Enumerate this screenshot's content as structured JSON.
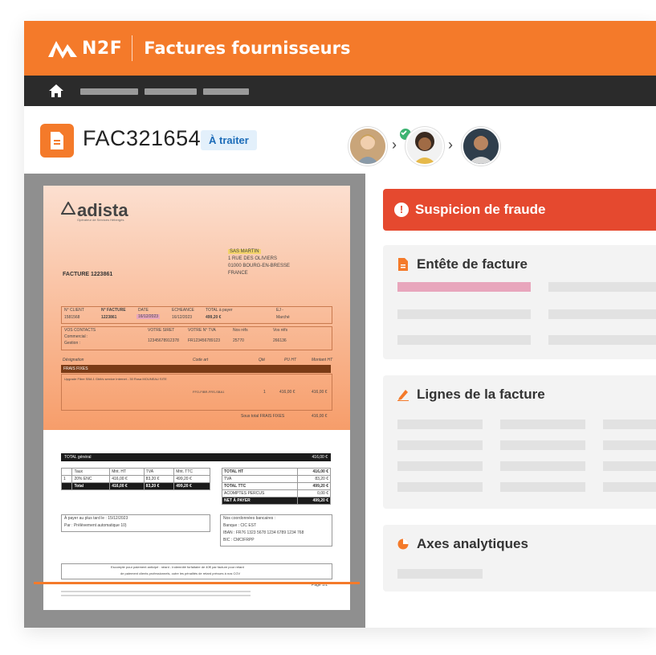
{
  "brand": {
    "logo_text": "N2F",
    "app_title": "Factures fournisseurs",
    "accent": "#f47a2a"
  },
  "navbar": {
    "home_label": "Accueil"
  },
  "invoice": {
    "id": "FAC321654",
    "status": "À traiter"
  },
  "approvers": [
    {
      "name": "approver-1",
      "approved": true
    },
    {
      "name": "approver-2",
      "approved": false
    },
    {
      "name": "approver-3",
      "approved": false
    }
  ],
  "document": {
    "supplier": "adista",
    "supplier_tagline": "Opérateur de Services Hébergés",
    "bill_to_name": "SAS MARTIN",
    "bill_to_lines": [
      "1 RUE DES OLIVIERS",
      "01000 BOURG-EN-BRESSE",
      "FRANCE"
    ],
    "title": "FACTURE 1223861",
    "meta_headers": [
      "N° CLIENT",
      "N° FACTURE",
      "DATE",
      "ECHEANCE",
      "TOTAL à payer",
      "EJ -"
    ],
    "meta_values": [
      "1581568",
      "1223861",
      "16/12/2023",
      "16/12/2023",
      "499,20 €",
      "Marché"
    ],
    "contacts_headers": [
      "VOS CONTACTS",
      "VOTRE SIRET",
      "VOTRE N° TVA",
      "Nos réfs",
      "Vos réfs"
    ],
    "contacts_labels": [
      "Commercial :",
      "Gestion :"
    ],
    "contacts_values": [
      "12345678912378",
      "FR123456789123",
      "25770",
      "266136"
    ],
    "lines_headers": [
      "Désignation",
      "Code art",
      "Qté",
      "PU HT",
      "Montant HT"
    ],
    "section": "FRAIS FIXES",
    "line_desc": "Upgrade Fibre SBA 1 Gbit/s service Internet - 30 Rosa MOUNEAU SITE",
    "line_code": "FFO-FIBR-FRS-SBA1",
    "line_qty": "1",
    "line_pu": "416,00 €",
    "line_amount": "416,00 €",
    "subtotal_label": "Sous total FRAIS FIXES",
    "subtotal_value": "416,00 €",
    "total_general_label": "TOTAL général",
    "total_general_value": "416,00 €",
    "vat_headers": [
      "Taux",
      "Mnt. HT",
      "TVA",
      "Mnt. TTC"
    ],
    "vat_row": [
      "1",
      "20% ENC",
      "416,00 €",
      "83,20 €",
      "499,20 €"
    ],
    "vat_total": [
      "Total",
      "416,00 €",
      "83,20 €",
      "499,20 €"
    ],
    "totals": [
      [
        "TOTAL HT",
        "416,00 €"
      ],
      [
        "TVA",
        "83,20 €"
      ],
      [
        "TOTAL TTC",
        "499,20 €"
      ],
      [
        "ACOMPTES PERCUS",
        "0,00 €"
      ],
      [
        "NET À PAYER",
        "499,20 €"
      ]
    ],
    "pay_by": "À payer au plus tard le : 15/12/2023",
    "pay_method": "Par : Prélèvement automatique 10)",
    "bank_title": "Nos coordonnées bancaires :",
    "bank_name": "Banque : CIC EST",
    "iban": "IBAN : FR76 1323 5678 1234 6789 1234 768",
    "bic": "BIC : CMCIFRPP",
    "footer_note_1": "Escompte pour paiement anticipé : néant - Indemnité forfaitaire de 40€ par facture pour retard",
    "footer_note_2": "de paiement clients professionnels, outre les pénalités de retard prévues à nos CGV",
    "page": "Page 1/1"
  },
  "panel": {
    "alert": "Suspicion de fraude",
    "alert_color": "#e5492f",
    "sections": [
      "Entête de facture",
      "Lignes de la facture",
      "Axes analytiques"
    ]
  }
}
